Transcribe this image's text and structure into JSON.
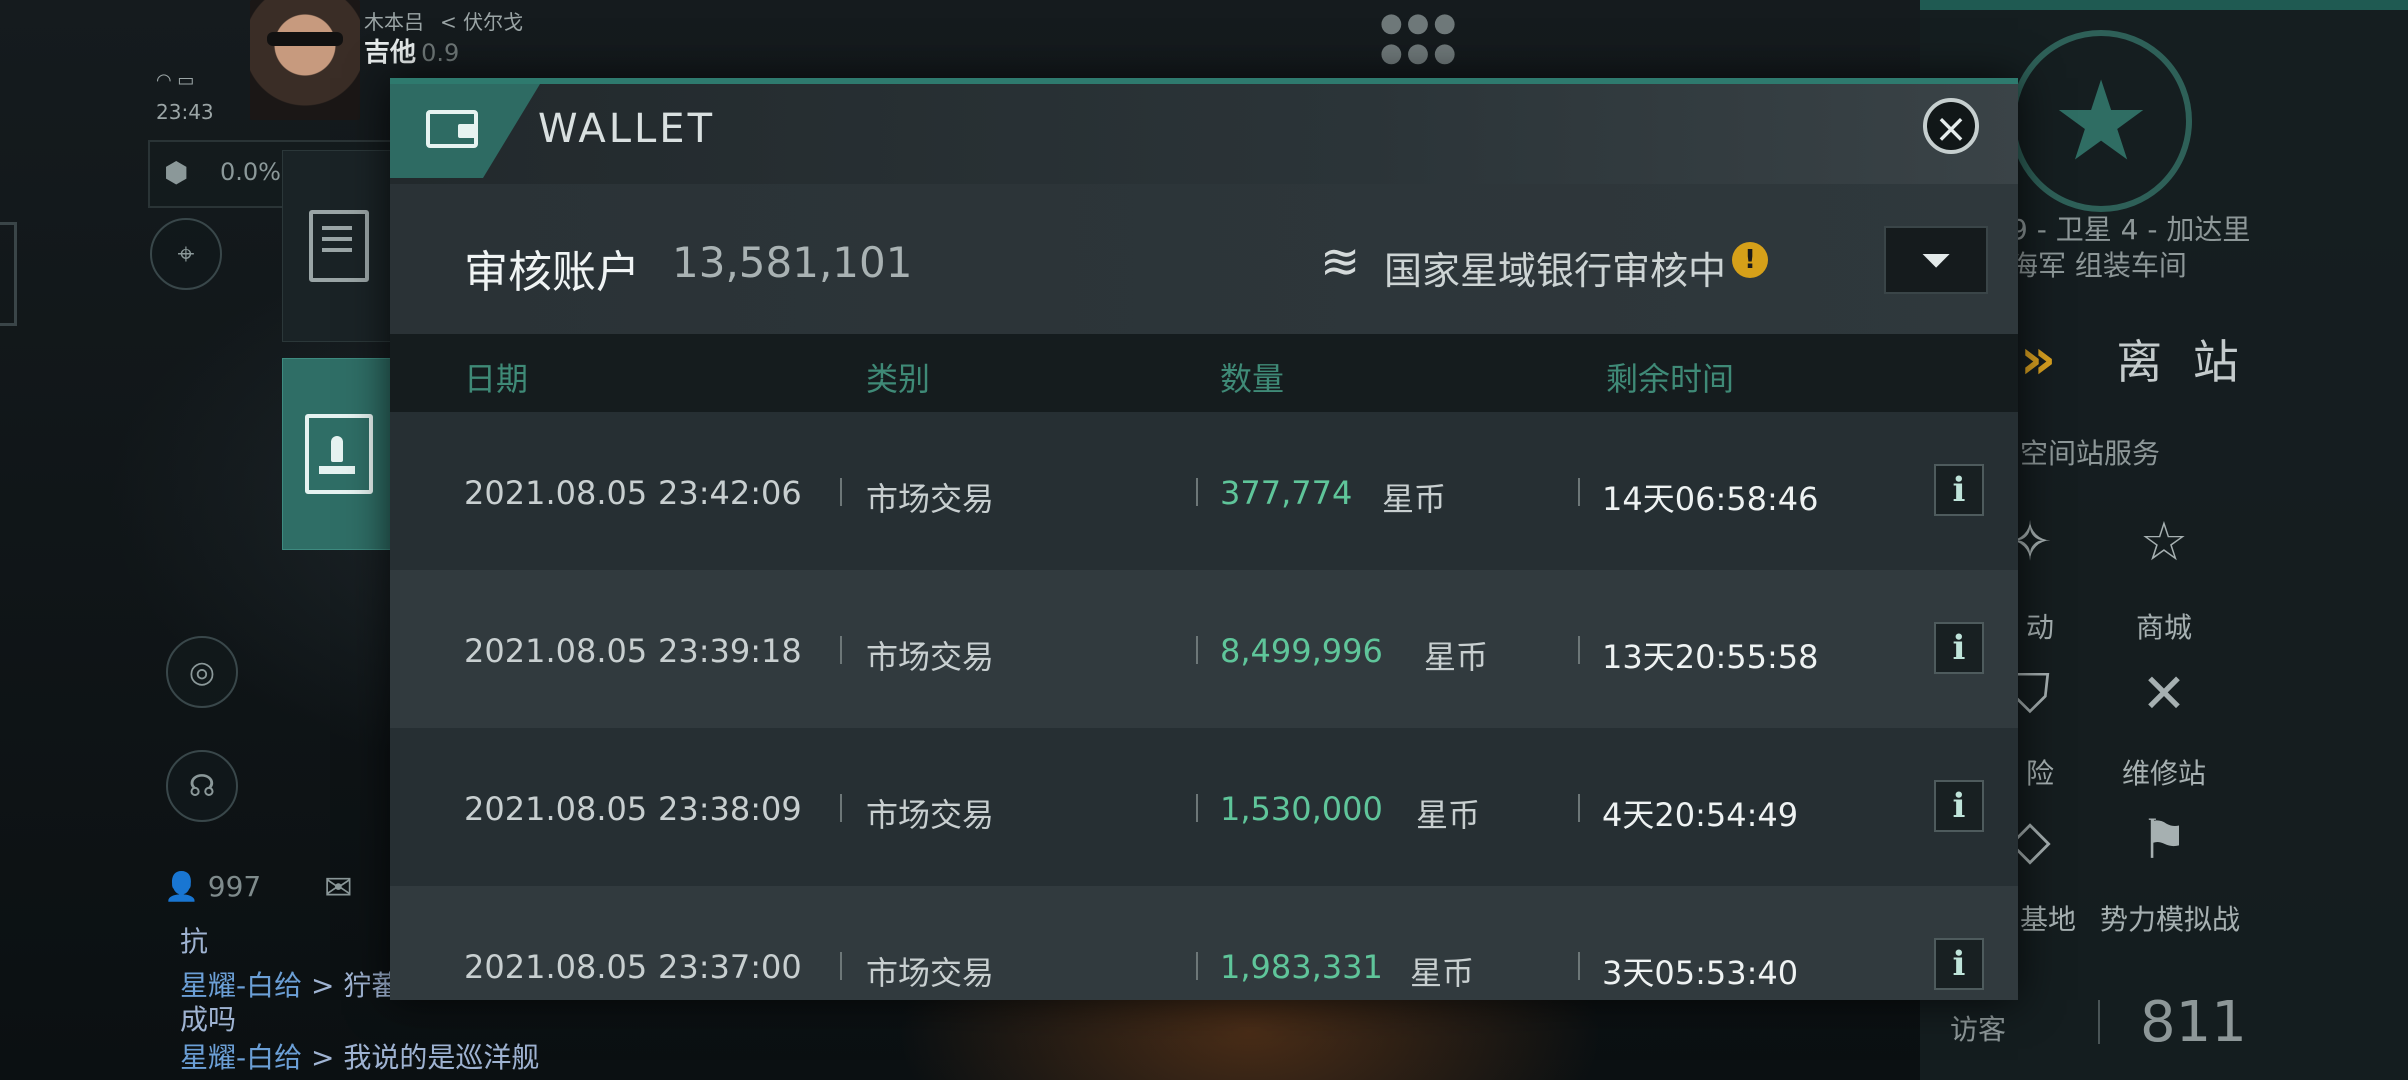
{
  "hud": {
    "corp": "木本吕",
    "system": "< 伏尔戈",
    "pilot_name": "吉他",
    "security": "0.9",
    "time": "23:43",
    "cargo_pct": "0.0%",
    "online_count": "997"
  },
  "chat": [
    {
      "text": "抗"
    },
    {
      "channel": "星耀-白给",
      "message": "> 狞蕃"
    },
    {
      "text": "成吗"
    },
    {
      "channel": "星耀-白给",
      "message": "> 我说的是巡洋舰"
    }
  ],
  "wallet": {
    "title": "WALLET",
    "account_label": "审核账户",
    "account_value": "13,581,101",
    "bank_status": "国家星域银行审核中",
    "columns": {
      "date": "日期",
      "category": "类别",
      "amount": "数量",
      "remaining": "剩余时间"
    },
    "currency": "星币",
    "rows": [
      {
        "date": "2021.08.05",
        "time": "23:42:06",
        "category": "市场交易",
        "amount": "377,774",
        "remaining": "14天06:58:46"
      },
      {
        "date": "2021.08.05",
        "time": "23:39:18",
        "category": "市场交易",
        "amount": "8,499,996",
        "remaining": "13天20:55:58"
      },
      {
        "date": "2021.08.05",
        "time": "23:38:09",
        "category": "市场交易",
        "amount": "1,530,000",
        "remaining": "4天20:54:49"
      },
      {
        "date": "2021.08.05",
        "time": "23:37:00",
        "category": "市场交易",
        "amount": "1,983,331",
        "remaining": "3天05:53:40"
      }
    ]
  },
  "station": {
    "location_line1": "9 - 卫星 4 - 加达里",
    "location_line2": "海军 组装车间",
    "undock_label": "离 站",
    "services_title": "空间站服务",
    "services": [
      {
        "label": "动",
        "icon": "✧"
      },
      {
        "label": "商城",
        "icon": "☆"
      },
      {
        "label": "险",
        "icon": "⛉"
      },
      {
        "label": "维修站",
        "icon": "✕"
      },
      {
        "label": "基地",
        "icon": "◇"
      },
      {
        "label": "势力模拟战",
        "icon": "⚑"
      }
    ],
    "visitor_label": "访客",
    "visitor_count": "811"
  }
}
